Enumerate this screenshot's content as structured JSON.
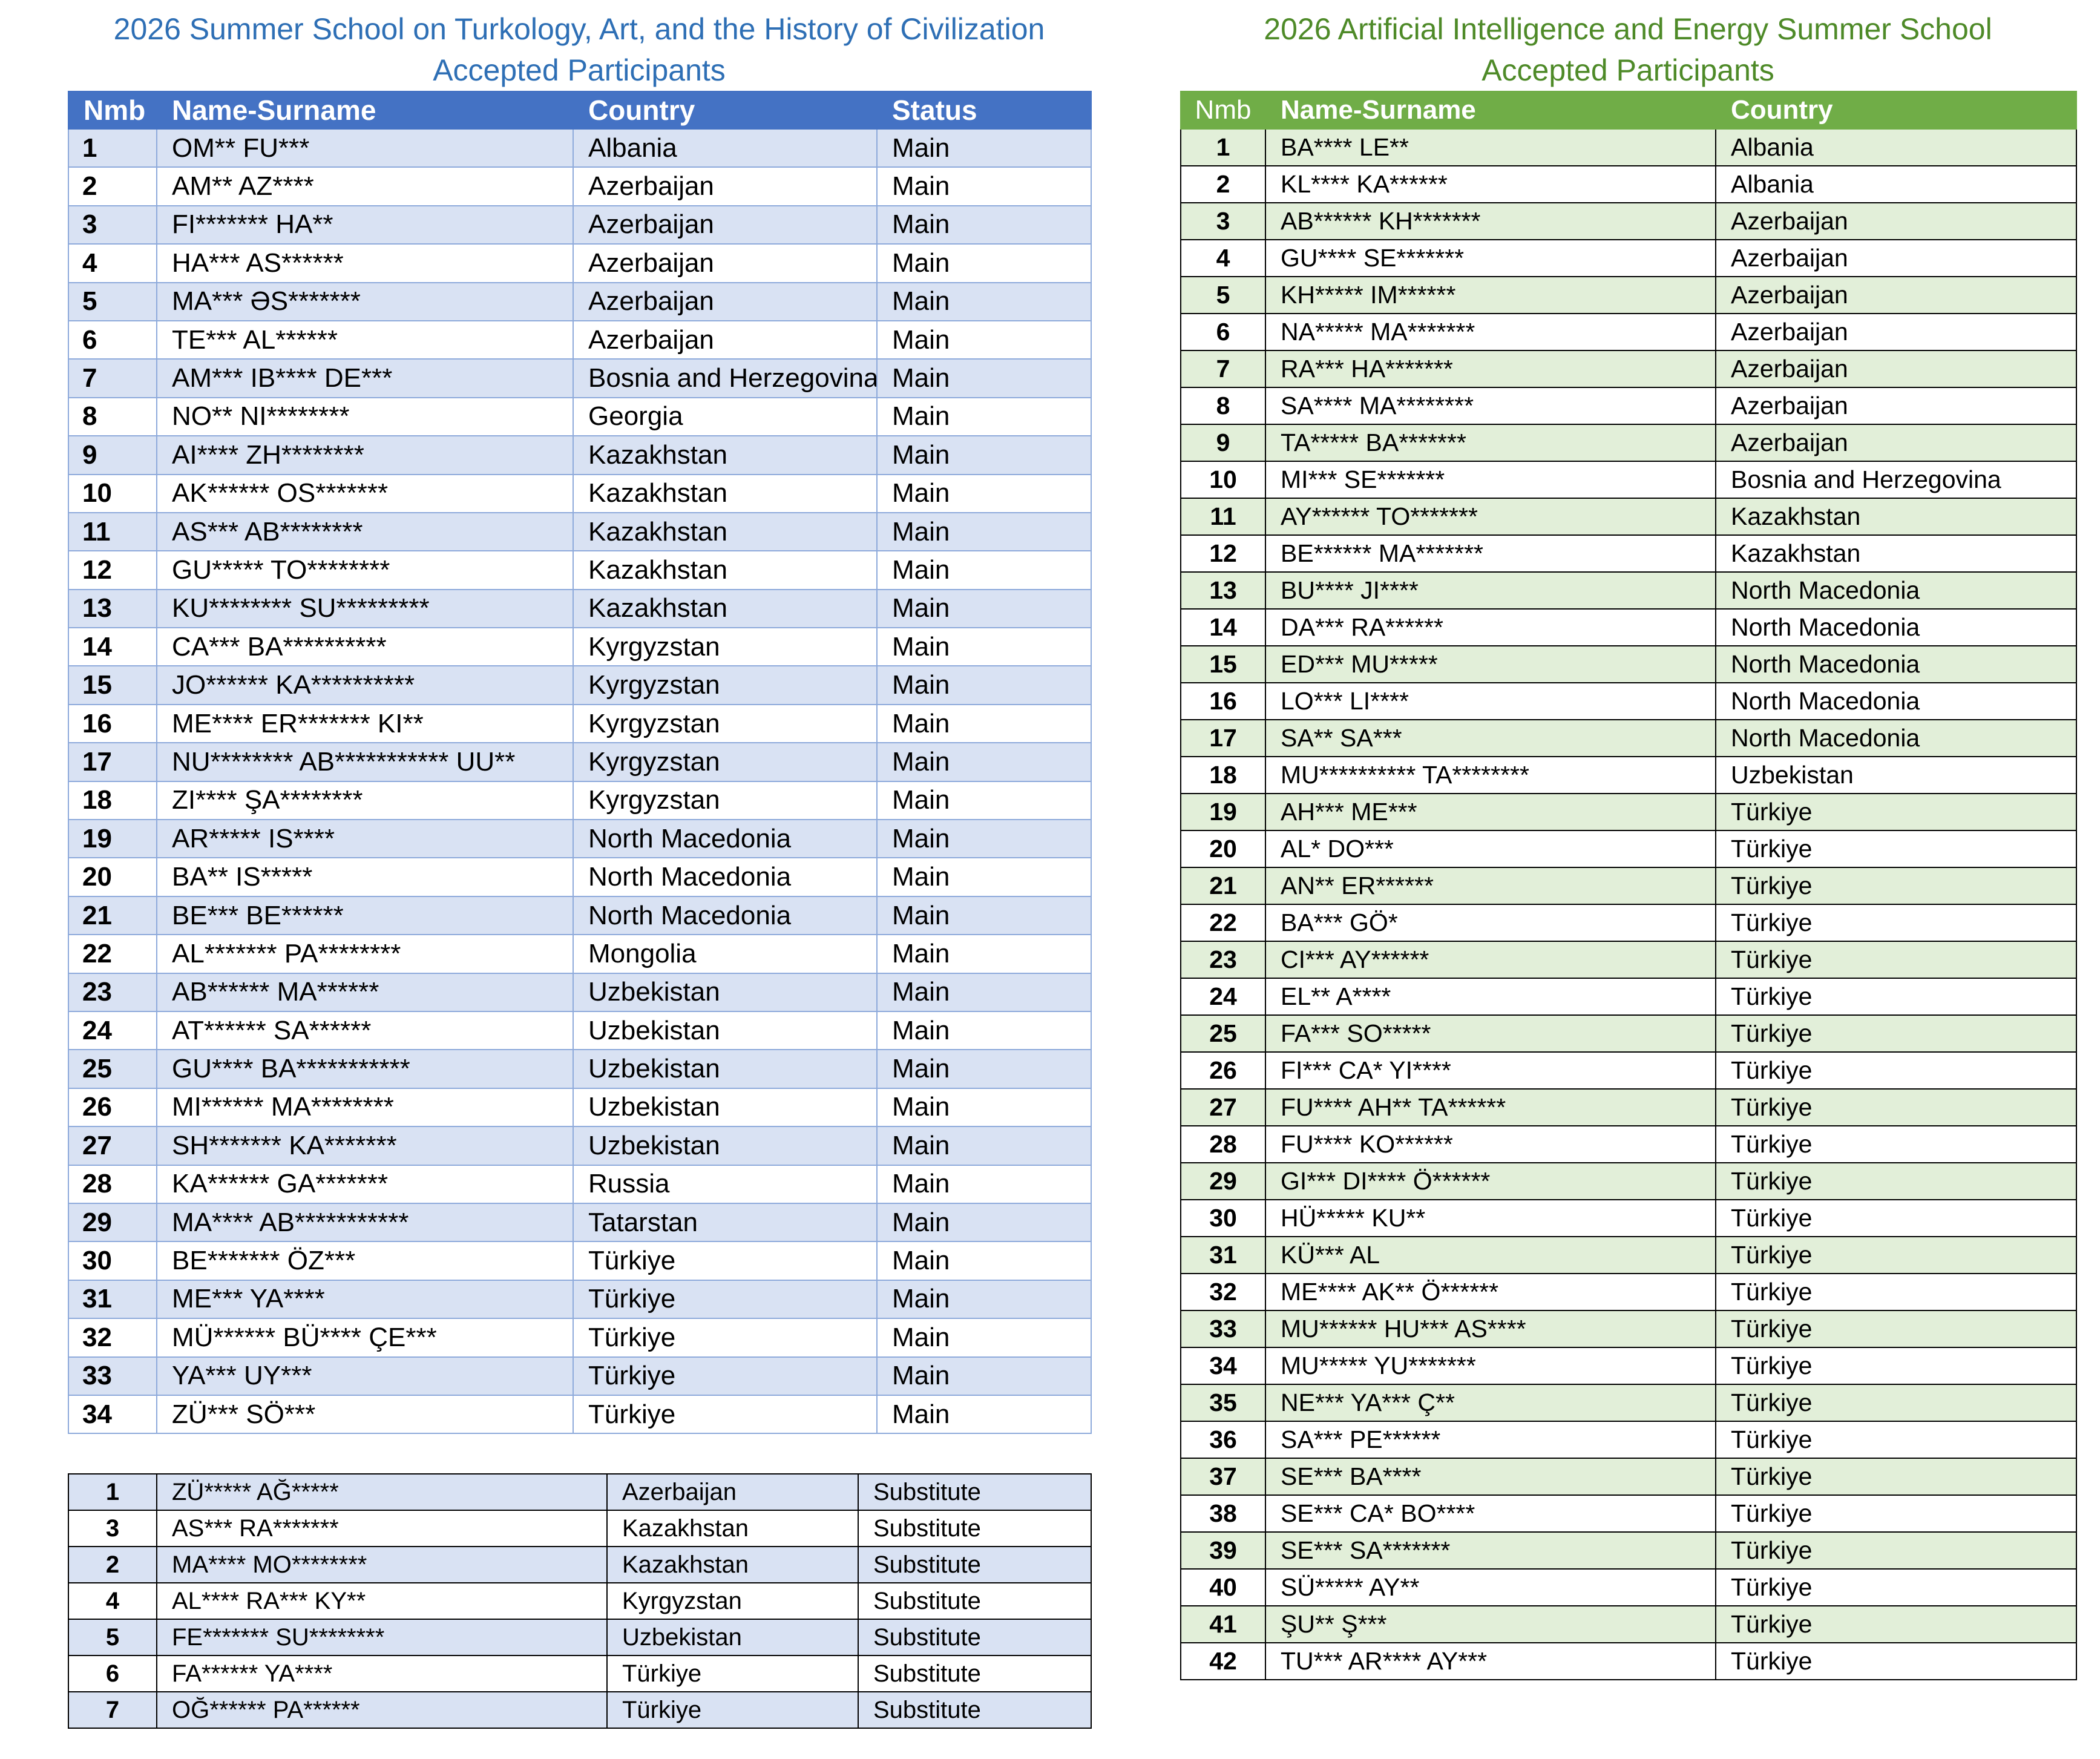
{
  "left": {
    "title_line1": "2026 Summer School on Turkology, Art, and the History of Civilization",
    "title_line2": "Accepted Participants",
    "headers": [
      "Nmb",
      "Name-Surname",
      "Country",
      "Status"
    ],
    "rows": [
      [
        "1",
        "OM** FU***",
        "Albania",
        "Main"
      ],
      [
        "2",
        "AM** AZ****",
        "Azerbaijan",
        "Main"
      ],
      [
        "3",
        "FI******* HA**",
        "Azerbaijan",
        "Main"
      ],
      [
        "4",
        "HA*** AS******",
        "Azerbaijan",
        "Main"
      ],
      [
        "5",
        "MA*** ƏS*******",
        "Azerbaijan",
        "Main"
      ],
      [
        "6",
        "TE*** AL******",
        "Azerbaijan",
        "Main"
      ],
      [
        "7",
        "AM*** IB**** DE***",
        "Bosnia and Herzegovina",
        "Main"
      ],
      [
        "8",
        "NO** NI********",
        "Georgia",
        "Main"
      ],
      [
        "9",
        "AI**** ZH********",
        "Kazakhstan",
        "Main"
      ],
      [
        "10",
        "AK****** OS*******",
        "Kazakhstan",
        "Main"
      ],
      [
        "11",
        "AS*** AB********",
        "Kazakhstan",
        "Main"
      ],
      [
        "12",
        "GU***** TO********",
        "Kazakhstan",
        "Main"
      ],
      [
        "13",
        "KU******** SU*********",
        "Kazakhstan",
        "Main"
      ],
      [
        "14",
        "CA*** BA**********",
        "Kyrgyzstan",
        "Main"
      ],
      [
        "15",
        "JO****** KA**********",
        "Kyrgyzstan",
        "Main"
      ],
      [
        "16",
        "ME**** ER******* KI**",
        "Kyrgyzstan",
        "Main"
      ],
      [
        "17",
        "NU******** AB*********** UU**",
        "Kyrgyzstan",
        "Main"
      ],
      [
        "18",
        "ZI**** ŞA********",
        "Kyrgyzstan",
        "Main"
      ],
      [
        "19",
        "AR***** IS****",
        "North Macedonia",
        "Main"
      ],
      [
        "20",
        "BA** IS*****",
        "North Macedonia",
        "Main"
      ],
      [
        "21",
        "BE*** BE******",
        "North Macedonia",
        "Main"
      ],
      [
        "22",
        "AL******* PA********",
        "Mongolia",
        "Main"
      ],
      [
        "23",
        "AB****** MA******",
        "Uzbekistan",
        "Main"
      ],
      [
        "24",
        "AT******  SA******",
        "Uzbekistan",
        "Main"
      ],
      [
        "25",
        "GU**** BA***********",
        "Uzbekistan",
        "Main"
      ],
      [
        "26",
        "MI****** MA********",
        "Uzbekistan",
        "Main"
      ],
      [
        "27",
        "SH******* KA*******",
        "Uzbekistan",
        "Main"
      ],
      [
        "28",
        "KA****** GA*******",
        "Russia",
        "Main"
      ],
      [
        "29",
        "MA**** AB***********",
        "Tatarstan",
        "Main"
      ],
      [
        "30",
        "BE******* ÖZ***",
        "Türkiye",
        "Main"
      ],
      [
        "31",
        "ME*** YA****",
        "Türkiye",
        "Main"
      ],
      [
        "32",
        "MÜ****** BÜ**** ÇE***",
        "Türkiye",
        "Main"
      ],
      [
        "33",
        "YA*** UY***",
        "Türkiye",
        "Main"
      ],
      [
        "34",
        "ZÜ*** SÖ***",
        "Türkiye",
        "Main"
      ]
    ],
    "substitutes": [
      [
        "1",
        "ZÜ***** AĞ*****",
        "Azerbaijan",
        "Substitute"
      ],
      [
        "3",
        "AS*** RA*******",
        "Kazakhstan",
        "Substitute"
      ],
      [
        "2",
        "MA**** MO********",
        "Kazakhstan",
        "Substitute"
      ],
      [
        "4",
        "AL**** RA*** KY**",
        "Kyrgyzstan",
        "Substitute"
      ],
      [
        "5",
        "FE******* SU********",
        "Uzbekistan",
        "Substitute"
      ],
      [
        "6",
        "FA****** YA****",
        "Türkiye",
        "Substitute"
      ],
      [
        "7",
        "OĞ****** PA******",
        "Türkiye",
        "Substitute"
      ]
    ]
  },
  "right": {
    "title_line1": "2026 Artificial Intelligence and Energy Summer School",
    "title_line2": "Accepted Participants",
    "headers": [
      "Nmb",
      "Name-Surname",
      "Country"
    ],
    "rows": [
      [
        "1",
        "BA**** LE**",
        "Albania"
      ],
      [
        "2",
        "KL**** KA******",
        "Albania"
      ],
      [
        "3",
        "AB****** KH*******",
        "Azerbaijan"
      ],
      [
        "4",
        "GU**** SE*******",
        "Azerbaijan"
      ],
      [
        "5",
        "KH***** IM******",
        "Azerbaijan"
      ],
      [
        "6",
        "NA***** MA*******",
        "Azerbaijan"
      ],
      [
        "7",
        "RA*** HA*******",
        "Azerbaijan"
      ],
      [
        "8",
        "SA**** MA********",
        "Azerbaijan"
      ],
      [
        "9",
        "TA***** BA*******",
        "Azerbaijan"
      ],
      [
        "10",
        "MI*** SE*******",
        "Bosnia and Herzegovina"
      ],
      [
        "11",
        "AY****** TO*******",
        "Kazakhstan"
      ],
      [
        "12",
        "BE****** MA*******",
        "Kazakhstan"
      ],
      [
        "13",
        "BU**** JI****",
        "North Macedonia"
      ],
      [
        "14",
        "DA*** RA******",
        "North Macedonia"
      ],
      [
        "15",
        "ED*** MU*****",
        "North Macedonia"
      ],
      [
        "16",
        "LO*** LI****",
        "North Macedonia"
      ],
      [
        "17",
        "SA** SA***",
        "North Macedonia"
      ],
      [
        "18",
        "MU********** TA********",
        "Uzbekistan"
      ],
      [
        "19",
        "AH*** ME***",
        "Türkiye"
      ],
      [
        "20",
        "AL* DO***",
        "Türkiye"
      ],
      [
        "21",
        "AN** ER******",
        "Türkiye"
      ],
      [
        "22",
        "BA*** GÖ*",
        "Türkiye"
      ],
      [
        "23",
        "CI*** AY******",
        "Türkiye"
      ],
      [
        "24",
        "EL** A****",
        "Türkiye"
      ],
      [
        "25",
        "FA*** SO*****",
        "Türkiye"
      ],
      [
        "26",
        "FI*** CA* YI****",
        "Türkiye"
      ],
      [
        "27",
        "FU**** AH** TA******",
        "Türkiye"
      ],
      [
        "28",
        "FU**** KO******",
        "Türkiye"
      ],
      [
        "29",
        "GI*** DI**** Ö******",
        "Türkiye"
      ],
      [
        "30",
        "HÜ***** KU**",
        "Türkiye"
      ],
      [
        "31",
        "KÜ*** AL",
        "Türkiye"
      ],
      [
        "32",
        "ME**** AK** Ö******",
        "Türkiye"
      ],
      [
        "33",
        "MU****** HU*** AS****",
        "Türkiye"
      ],
      [
        "34",
        "MU***** YU*******",
        "Türkiye"
      ],
      [
        "35",
        "NE*** YA*** Ç**",
        "Türkiye"
      ],
      [
        "36",
        "SA*** PE******",
        "Türkiye"
      ],
      [
        "37",
        "SE*** BA****",
        "Türkiye"
      ],
      [
        "38",
        "SE*** CA* BO****",
        "Türkiye"
      ],
      [
        "39",
        "SE*** SA*******",
        "Türkiye"
      ],
      [
        "40",
        "SÜ***** AY**",
        "Türkiye"
      ],
      [
        "41",
        "ŞU** Ş***",
        "Türkiye"
      ],
      [
        "42",
        "TU*** AR**** AY***",
        "Türkiye"
      ]
    ]
  },
  "colors": {
    "left_title": "#2e6fb5",
    "left_header": "#4472c4",
    "left_band": "#d9e2f3",
    "right_title": "#4e8a28",
    "right_header": "#70ad47",
    "right_band": "#e2efd9"
  }
}
